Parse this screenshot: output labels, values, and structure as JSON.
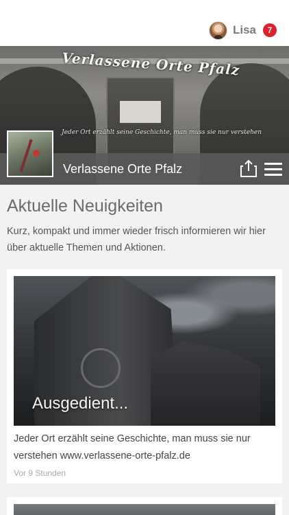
{
  "user": {
    "name": "Lisa",
    "notification_count": "7"
  },
  "hero": {
    "banner_title": "Verlassene Orte Pfalz",
    "banner_slogan": "Jeder Ort erzählt seine Geschichte, man muss sie nur verstehen",
    "page_name": "Verlassene Orte Pfalz",
    "share_icon": "share-icon",
    "menu_icon": "hamburger-menu-icon"
  },
  "section": {
    "title": "Aktuelle Neuigkeiten",
    "intro": "Kurz, kompakt und immer wieder frisch informieren wir hier über aktuelle Themen und Aktionen."
  },
  "posts": [
    {
      "image_title": "Ausgedient...",
      "text": "Jeder Ort erzählt seine Geschichte, man muss sie nur verstehen www.verlassene-orte-pfalz.de",
      "time": "Vor 9 Stunden"
    }
  ],
  "colors": {
    "badge": "#e0212b",
    "bar": "#5a5a5a",
    "background": "#f2f2f2"
  }
}
